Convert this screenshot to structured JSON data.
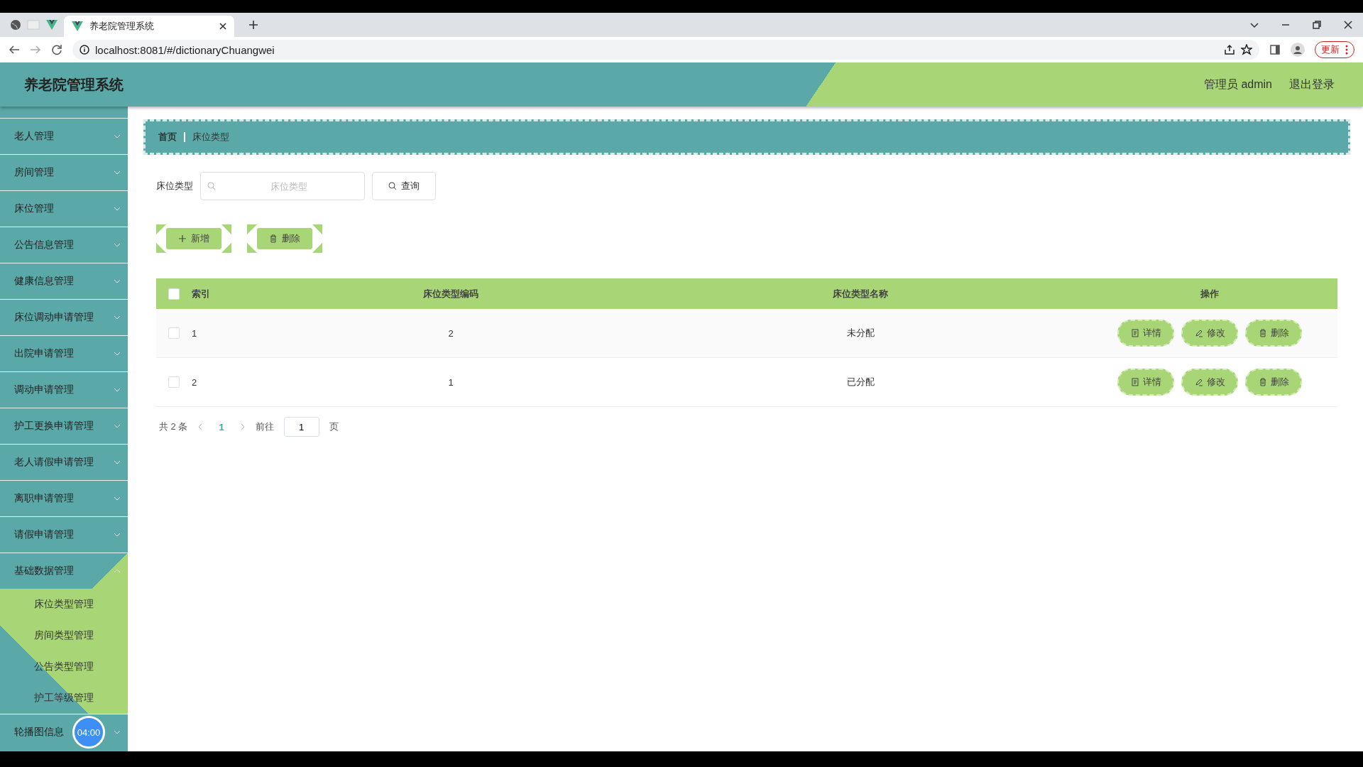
{
  "browser": {
    "tab_title": "养老院管理系统",
    "url": "localhost:8081/#/dictionaryChuangwei",
    "update_button": "更新"
  },
  "header": {
    "title": "养老院管理系统",
    "user": "管理员 admin",
    "logout": "退出登录"
  },
  "sidebar": {
    "items": [
      {
        "label": "老人管理",
        "expanded": false
      },
      {
        "label": "房间管理",
        "expanded": false
      },
      {
        "label": "床位管理",
        "expanded": false
      },
      {
        "label": "公告信息管理",
        "expanded": false
      },
      {
        "label": "健康信息管理",
        "expanded": false
      },
      {
        "label": "床位调动申请管理",
        "expanded": false
      },
      {
        "label": "出院申请管理",
        "expanded": false
      },
      {
        "label": "调动申请管理",
        "expanded": false
      },
      {
        "label": "护工更换申请管理",
        "expanded": false
      },
      {
        "label": "老人请假申请管理",
        "expanded": false
      },
      {
        "label": "离职申请管理",
        "expanded": false
      },
      {
        "label": "请假申请管理",
        "expanded": false
      },
      {
        "label": "基础数据管理",
        "expanded": true,
        "children": [
          {
            "label": "床位类型管理"
          },
          {
            "label": "房间类型管理"
          },
          {
            "label": "公告类型管理"
          },
          {
            "label": "护工等级管理"
          }
        ]
      },
      {
        "label": "轮播图信息",
        "expanded": false
      }
    ]
  },
  "timer_badge": "04:00",
  "breadcrumb": [
    "首页",
    "床位类型"
  ],
  "search": {
    "label": "床位类型",
    "placeholder": "床位类型",
    "button": "查询"
  },
  "actions": [
    "新增",
    "删除"
  ],
  "table": {
    "select_all_checked": false,
    "columns": [
      "索引",
      "床位类型编码",
      "床位类型名称",
      "操作"
    ],
    "rows": [
      {
        "checked": false,
        "cells": [
          "1",
          "2",
          "未分配"
        ],
        "actions": [
          "详情",
          "修改",
          "删除"
        ]
      },
      {
        "checked": false,
        "cells": [
          "2",
          "1",
          "已分配"
        ],
        "actions": [
          "详情",
          "修改",
          "删除"
        ]
      }
    ]
  },
  "pagination": {
    "total": "共 2 条",
    "current_page": "1",
    "goto_label": "前往",
    "goto_value": "1",
    "page_unit": "页"
  }
}
